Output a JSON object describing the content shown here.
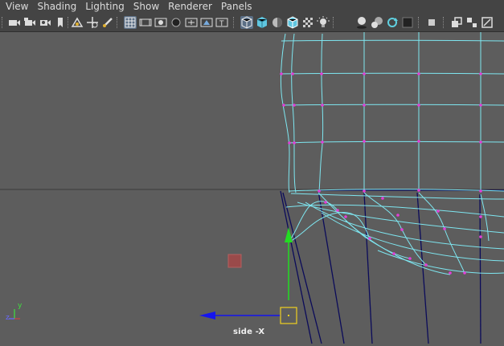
{
  "menu": [
    "View",
    "Shading",
    "Lighting",
    "Show",
    "Renderer",
    "Panels"
  ],
  "toolbar": {
    "icons": [
      "select-camera-icon",
      "camera-attributes-icon",
      "camera-bookmark-icon",
      "bookmark-icon",
      "image-plane-icon",
      "2d-pan-zoom-icon",
      "grease-pencil-icon",
      "grid-icon",
      "film-gate-icon",
      "resolution-gate-icon",
      "gate-mask-icon",
      "field-chart-icon",
      "safe-action-icon",
      "safe-title-icon",
      "wireframe-icon",
      "smooth-shade-icon",
      "use-default-material-icon",
      "wireframe-on-shaded-icon",
      "xray-icon",
      "all-lights-icon",
      "shadows-icon",
      "screen-space-ao-icon",
      "motion-blur-icon",
      "anti-aliasing-icon",
      "depth-of-field-icon",
      "isolate-select-icon",
      "xray-joints-icon",
      "textured-icon"
    ]
  },
  "viewport": {
    "camera_label": "side -X",
    "axis_y": "y",
    "axis_z": "z",
    "colors": {
      "background": "#5d5d5d",
      "wire_selected": "#7ee6f0",
      "wire_dark": "#0b0b5a",
      "vertex": "#e23fd8",
      "manip_y": "#22dd22",
      "manip_z": "#1515ee",
      "pivot": "#f0d020",
      "marker": "#9a4a4a"
    }
  }
}
